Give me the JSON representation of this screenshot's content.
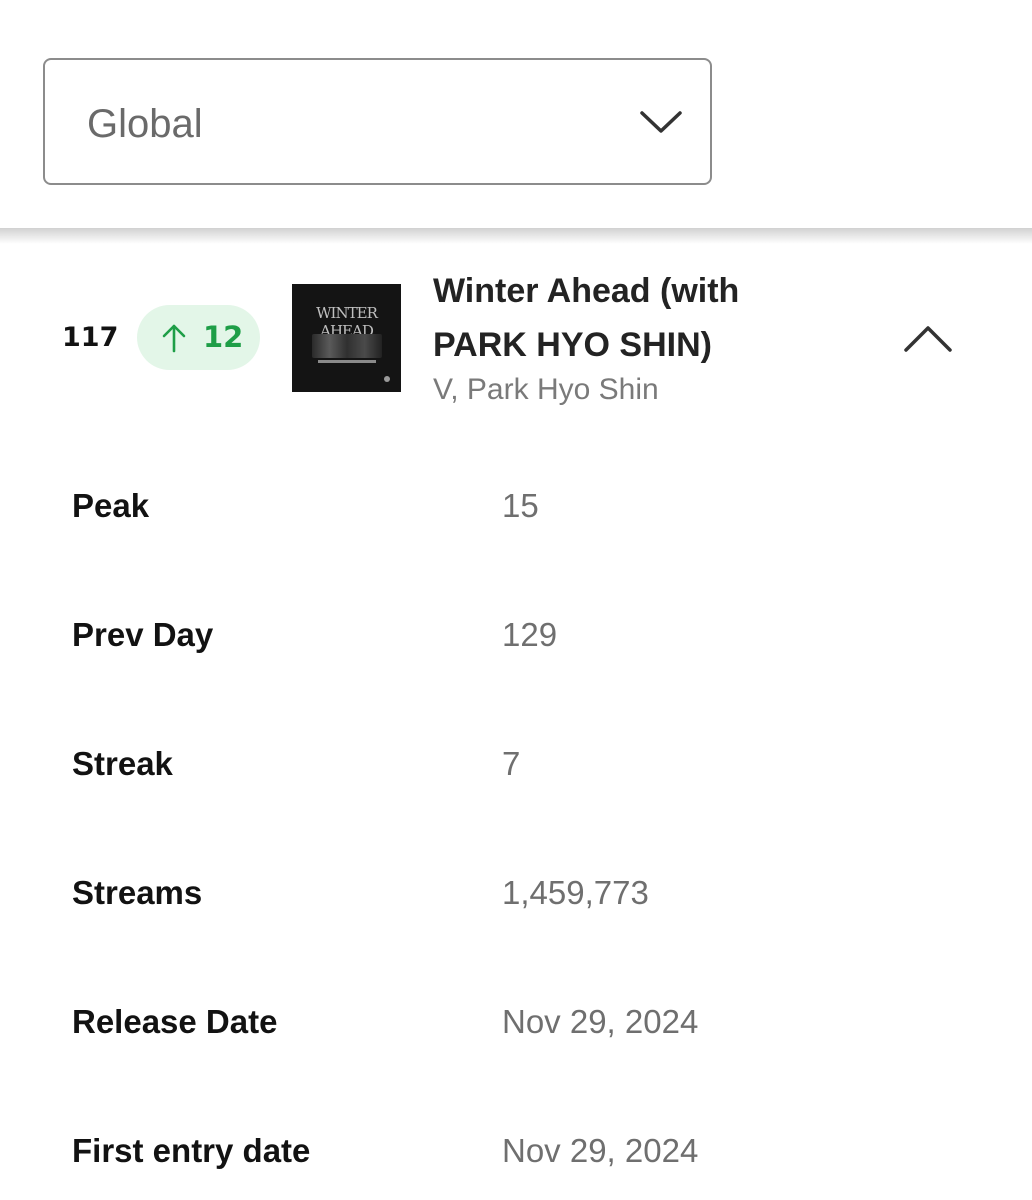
{
  "region_select": {
    "value": "Global",
    "icon": "chevron-down-icon"
  },
  "track": {
    "rank": "117",
    "change": {
      "direction": "up",
      "icon": "arrow-up-icon",
      "value": "12",
      "color": "#1e9e47",
      "background": "#e3f6e8"
    },
    "cover_text": "WINTER AHEAD",
    "title_line1": "Winter Ahead (with",
    "title_line2": "PARK HYO SHIN)",
    "artists": "V, Park Hyo Shin",
    "collapse_icon": "chevron-up-icon"
  },
  "details": [
    {
      "label": "Peak",
      "value": "15"
    },
    {
      "label": "Prev Day",
      "value": "129"
    },
    {
      "label": "Streak",
      "value": "7"
    },
    {
      "label": "Streams",
      "value": "1,459,773"
    },
    {
      "label": "Release Date",
      "value": "Nov 29, 2024"
    },
    {
      "label": "First entry date",
      "value": "Nov 29, 2024"
    }
  ]
}
